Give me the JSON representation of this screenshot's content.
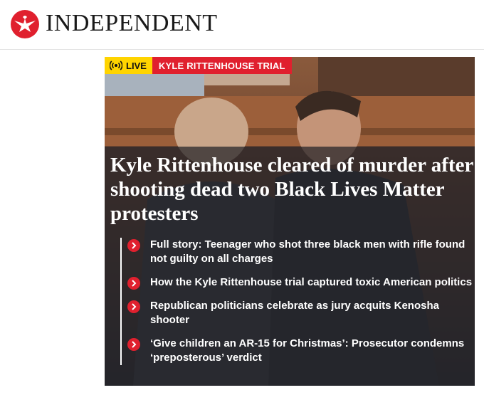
{
  "header": {
    "brand": "INDEPENDENT",
    "logo_icon": "eagle-icon",
    "brand_color": "#e0202e"
  },
  "hero": {
    "live_label": "LIVE",
    "live_icon": "broadcast-icon",
    "topic_label": "KYLE RITTENHOUSE TRIAL",
    "headline": "Kyle Rittenhouse cleared of murder after shooting dead two Black Lives Matter protesters",
    "links": [
      {
        "text": "Full story: Teenager who shot three black men with rifle found not guilty on all charges",
        "icon": "chevron-right-icon"
      },
      {
        "text": "How the Kyle Rittenhouse trial captured toxic American politics",
        "icon": "chevron-right-icon"
      },
      {
        "text": "Republican politicians celebrate as jury acquits Kenosha shooter",
        "icon": "chevron-right-icon"
      },
      {
        "text": "‘Give children an AR-15 for Christmas’: Prosecutor condemns ‘preposterous’ verdict",
        "icon": "chevron-right-icon"
      }
    ]
  },
  "colors": {
    "live_badge": "#ffd400",
    "topic_badge": "#e0202e",
    "overlay": "#222328"
  }
}
